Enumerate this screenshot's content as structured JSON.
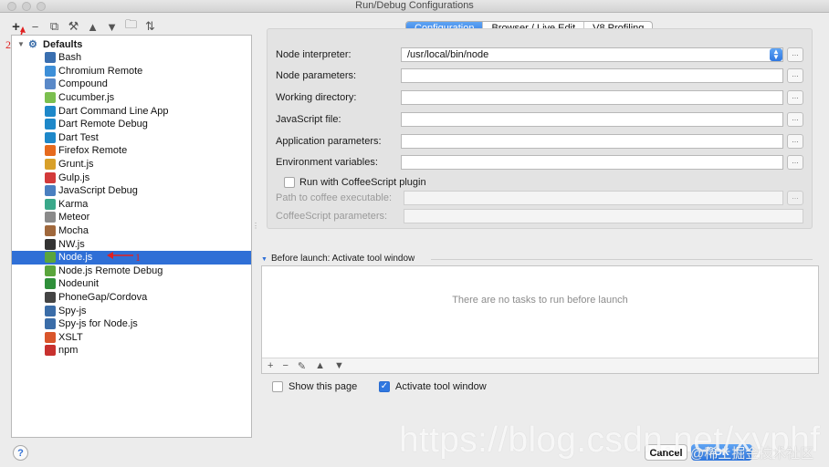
{
  "window": {
    "title": "Run/Debug Configurations"
  },
  "toolbar": {
    "buttons": [
      {
        "name": "add-button",
        "icon": "plus-icon",
        "glyph": "+"
      },
      {
        "name": "remove-button",
        "icon": "minus-icon",
        "glyph": "−"
      },
      {
        "name": "copy-button",
        "icon": "copy-icon",
        "glyph": "⧉"
      },
      {
        "name": "edit-defaults-button",
        "icon": "wrench-icon",
        "glyph": "⚒"
      },
      {
        "name": "move-up-button",
        "icon": "arrow-up-icon",
        "glyph": "▲"
      },
      {
        "name": "move-down-button",
        "icon": "arrow-down-icon",
        "glyph": "▼"
      },
      {
        "name": "folder-button",
        "icon": "folder-icon",
        "glyph": "🗀"
      },
      {
        "name": "sort-button",
        "icon": "sort-icon",
        "glyph": "⇅"
      }
    ]
  },
  "tree": {
    "root_label": "Defaults",
    "items": [
      {
        "label": "Bash",
        "color": "#3a6fb0"
      },
      {
        "label": "Chromium Remote",
        "color": "#3d8fd8"
      },
      {
        "label": "Compound",
        "color": "#5a89c8"
      },
      {
        "label": "Cucumber.js",
        "color": "#7bbf4f"
      },
      {
        "label": "Dart Command Line App",
        "color": "#1e88c9"
      },
      {
        "label": "Dart Remote Debug",
        "color": "#1e88c9"
      },
      {
        "label": "Dart Test",
        "color": "#1e88c9"
      },
      {
        "label": "Firefox Remote",
        "color": "#e66a1e"
      },
      {
        "label": "Grunt.js",
        "color": "#d8a02a"
      },
      {
        "label": "Gulp.js",
        "color": "#d33a3a"
      },
      {
        "label": "JavaScript Debug",
        "color": "#4a7fc0"
      },
      {
        "label": "Karma",
        "color": "#3aa88a"
      },
      {
        "label": "Meteor",
        "color": "#8a8a8a"
      },
      {
        "label": "Mocha",
        "color": "#a0683c"
      },
      {
        "label": "NW.js",
        "color": "#333333"
      },
      {
        "label": "Node.js",
        "color": "#5aa53c",
        "selected": true
      },
      {
        "label": "Node.js Remote Debug",
        "color": "#5aa53c"
      },
      {
        "label": "Nodeunit",
        "color": "#2f8f3a"
      },
      {
        "label": "PhoneGap/Cordova",
        "color": "#444444"
      },
      {
        "label": "Spy-js",
        "color": "#3b6da8"
      },
      {
        "label": "Spy-js for Node.js",
        "color": "#3b6da8"
      },
      {
        "label": "XSLT",
        "color": "#d9552b"
      },
      {
        "label": "npm",
        "color": "#c8312f"
      }
    ]
  },
  "tabs": [
    {
      "label": "Configuration",
      "active": true
    },
    {
      "label": "Browser / Live Edit",
      "active": false
    },
    {
      "label": "V8 Profiling",
      "active": false
    }
  ],
  "form": {
    "node_interpreter": {
      "label": "Node interpreter:",
      "value": "/usr/local/bin/node"
    },
    "node_parameters": {
      "label": "Node parameters:",
      "value": ""
    },
    "working_directory": {
      "label": "Working directory:",
      "value": ""
    },
    "javascript_file": {
      "label": "JavaScript file:",
      "value": ""
    },
    "application_parameters": {
      "label": "Application parameters:",
      "value": ""
    },
    "environment_variables": {
      "label": "Environment variables:",
      "value": ""
    },
    "coffeescript_plugin": {
      "label": "Run with CoffeeScript plugin",
      "checked": false
    },
    "coffee_path": {
      "label": "Path to coffee executable:",
      "value": ""
    },
    "coffee_params": {
      "label": "CoffeeScript parameters:",
      "value": ""
    },
    "browse_label": "..."
  },
  "before_launch": {
    "header": "Before launch: Activate tool window",
    "empty_text": "There are no tasks to run before launch"
  },
  "footer": {
    "show_page": {
      "label": "Show this page",
      "checked": false
    },
    "activate_tool_window": {
      "label": "Activate tool window",
      "checked": true
    },
    "help_label": "?",
    "cancel_label": "Cancel",
    "ok_label": "OK"
  },
  "annotations": {
    "step1": "1",
    "step2": "2"
  },
  "watermark": {
    "url": "https://blog.csdn.net/xyphf",
    "credit": "@稀土掘金技术社区"
  }
}
